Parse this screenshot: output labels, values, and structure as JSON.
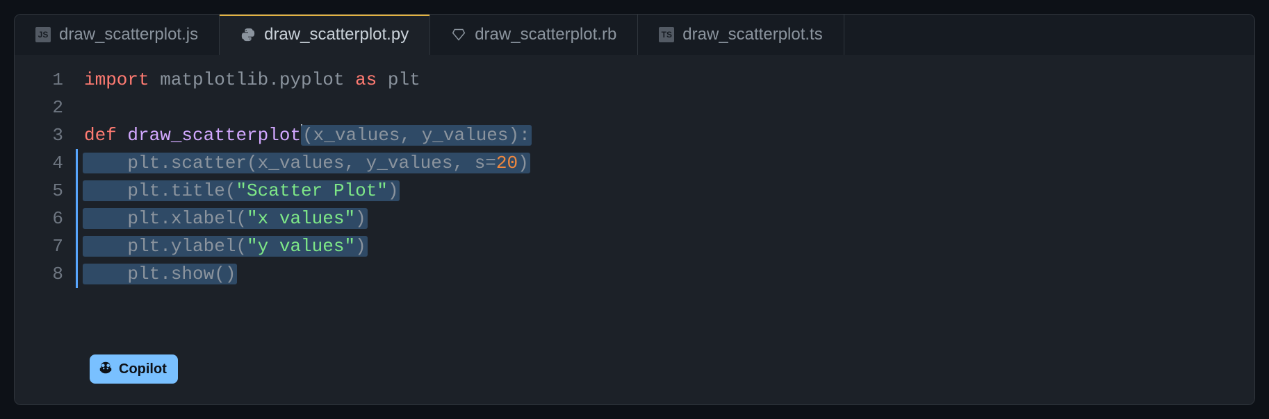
{
  "tabs": [
    {
      "label": "draw_scatterplot.js",
      "icon": "JS",
      "active": false
    },
    {
      "label": "draw_scatterplot.py",
      "icon": "py",
      "active": true
    },
    {
      "label": "draw_scatterplot.rb",
      "icon": "rb",
      "active": false
    },
    {
      "label": "draw_scatterplot.ts",
      "icon": "TS",
      "active": false
    }
  ],
  "code": {
    "line1": {
      "kw1": "import",
      "mod": " matplotlib.pyplot ",
      "kw2": "as",
      "alias": " plt"
    },
    "line3": {
      "kw": "def",
      "fn": " draw_scatterplot",
      "sugg": "(x_values, y_values):"
    },
    "line4": {
      "pre": "    plt.scatter(x_values, y_values, s=",
      "num": "20",
      "post": ")"
    },
    "line5": {
      "pre": "    plt.title(",
      "str": "\"Scatter Plot\"",
      "post": ")"
    },
    "line6": {
      "pre": "    plt.xlabel(",
      "str": "\"x values\"",
      "post": ")"
    },
    "line7": {
      "pre": "    plt.ylabel(",
      "str": "\"y values\"",
      "post": ")"
    },
    "line8": {
      "text": "    plt.show()"
    }
  },
  "line_numbers": [
    "1",
    "2",
    "3",
    "4",
    "5",
    "6",
    "7",
    "8"
  ],
  "copilot_label": "Copilot"
}
